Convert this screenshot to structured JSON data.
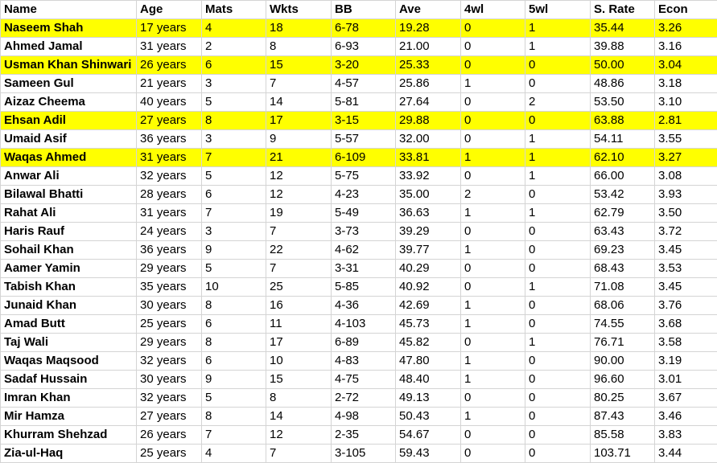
{
  "columns": [
    "Name",
    "Age",
    "Mats",
    "Wkts",
    "BB",
    "Ave",
    "4wl",
    "5wl",
    "S. Rate",
    "Econ"
  ],
  "highlight_color": "#ffff00",
  "rows": [
    {
      "name": "Naseem Shah",
      "age": "17 years",
      "mats": "4",
      "wkts": "18",
      "bb": "6-78",
      "ave": "19.28",
      "w4": "0",
      "w5": "1",
      "sr": "35.44",
      "econ": "3.26",
      "highlighted": true
    },
    {
      "name": "Ahmed Jamal",
      "age": "31 years",
      "mats": "2",
      "wkts": "8",
      "bb": "6-93",
      "ave": "21.00",
      "w4": "0",
      "w5": "1",
      "sr": "39.88",
      "econ": "3.16",
      "highlighted": false
    },
    {
      "name": "Usman Khan Shinwari",
      "age": "26 years",
      "mats": "6",
      "wkts": "15",
      "bb": "3-20",
      "ave": "25.33",
      "w4": "0",
      "w5": "0",
      "sr": "50.00",
      "econ": "3.04",
      "highlighted": true
    },
    {
      "name": "Sameen Gul",
      "age": "21 years",
      "mats": "3",
      "wkts": "7",
      "bb": "4-57",
      "ave": "25.86",
      "w4": "1",
      "w5": "0",
      "sr": "48.86",
      "econ": "3.18",
      "highlighted": false
    },
    {
      "name": "Aizaz Cheema",
      "age": "40 years",
      "mats": "5",
      "wkts": "14",
      "bb": "5-81",
      "ave": "27.64",
      "w4": "0",
      "w5": "2",
      "sr": "53.50",
      "econ": "3.10",
      "highlighted": false
    },
    {
      "name": "Ehsan Adil",
      "age": "27 years",
      "mats": "8",
      "wkts": "17",
      "bb": "3-15",
      "ave": "29.88",
      "w4": "0",
      "w5": "0",
      "sr": "63.88",
      "econ": "2.81",
      "highlighted": true
    },
    {
      "name": "Umaid Asif",
      "age": "36 years",
      "mats": "3",
      "wkts": "9",
      "bb": "5-57",
      "ave": "32.00",
      "w4": "0",
      "w5": "1",
      "sr": "54.11",
      "econ": "3.55",
      "highlighted": false
    },
    {
      "name": "Waqas Ahmed",
      "age": "31 years",
      "mats": "7",
      "wkts": "21",
      "bb": "6-109",
      "ave": "33.81",
      "w4": "1",
      "w5": "1",
      "sr": "62.10",
      "econ": "3.27",
      "highlighted": true
    },
    {
      "name": "Anwar Ali",
      "age": "32 years",
      "mats": "5",
      "wkts": "12",
      "bb": "5-75",
      "ave": "33.92",
      "w4": "0",
      "w5": "1",
      "sr": "66.00",
      "econ": "3.08",
      "highlighted": false
    },
    {
      "name": "Bilawal Bhatti",
      "age": "28 years",
      "mats": "6",
      "wkts": "12",
      "bb": "4-23",
      "ave": "35.00",
      "w4": "2",
      "w5": "0",
      "sr": "53.42",
      "econ": "3.93",
      "highlighted": false
    },
    {
      "name": "Rahat Ali",
      "age": "31 years",
      "mats": "7",
      "wkts": "19",
      "bb": "5-49",
      "ave": "36.63",
      "w4": "1",
      "w5": "1",
      "sr": "62.79",
      "econ": "3.50",
      "highlighted": false
    },
    {
      "name": "Haris Rauf",
      "age": "24 years",
      "mats": "3",
      "wkts": "7",
      "bb": "3-73",
      "ave": "39.29",
      "w4": "0",
      "w5": "0",
      "sr": "63.43",
      "econ": "3.72",
      "highlighted": false
    },
    {
      "name": "Sohail Khan",
      "age": "36 years",
      "mats": "9",
      "wkts": "22",
      "bb": "4-62",
      "ave": "39.77",
      "w4": "1",
      "w5": "0",
      "sr": "69.23",
      "econ": "3.45",
      "highlighted": false
    },
    {
      "name": "Aamer Yamin",
      "age": "29 years",
      "mats": "5",
      "wkts": "7",
      "bb": "3-31",
      "ave": "40.29",
      "w4": "0",
      "w5": "0",
      "sr": "68.43",
      "econ": "3.53",
      "highlighted": false
    },
    {
      "name": "Tabish Khan",
      "age": "35 years",
      "mats": "10",
      "wkts": "25",
      "bb": "5-85",
      "ave": "40.92",
      "w4": "0",
      "w5": "1",
      "sr": "71.08",
      "econ": "3.45",
      "highlighted": false
    },
    {
      "name": "Junaid Khan",
      "age": "30 years",
      "mats": "8",
      "wkts": "16",
      "bb": "4-36",
      "ave": "42.69",
      "w4": "1",
      "w5": "0",
      "sr": "68.06",
      "econ": "3.76",
      "highlighted": false
    },
    {
      "name": "Amad Butt",
      "age": "25 years",
      "mats": "6",
      "wkts": "11",
      "bb": "4-103",
      "ave": "45.73",
      "w4": "1",
      "w5": "0",
      "sr": "74.55",
      "econ": "3.68",
      "highlighted": false
    },
    {
      "name": "Taj Wali",
      "age": "29 years",
      "mats": "8",
      "wkts": "17",
      "bb": "6-89",
      "ave": "45.82",
      "w4": "0",
      "w5": "1",
      "sr": "76.71",
      "econ": "3.58",
      "highlighted": false
    },
    {
      "name": "Waqas Maqsood",
      "age": "32 years",
      "mats": "6",
      "wkts": "10",
      "bb": "4-83",
      "ave": "47.80",
      "w4": "1",
      "w5": "0",
      "sr": "90.00",
      "econ": "3.19",
      "highlighted": false
    },
    {
      "name": "Sadaf Hussain",
      "age": "30 years",
      "mats": "9",
      "wkts": "15",
      "bb": "4-75",
      "ave": "48.40",
      "w4": "1",
      "w5": "0",
      "sr": "96.60",
      "econ": "3.01",
      "highlighted": false
    },
    {
      "name": "Imran Khan",
      "age": "32 years",
      "mats": "5",
      "wkts": "8",
      "bb": "2-72",
      "ave": "49.13",
      "w4": "0",
      "w5": "0",
      "sr": "80.25",
      "econ": "3.67",
      "highlighted": false
    },
    {
      "name": "Mir Hamza",
      "age": "27 years",
      "mats": "8",
      "wkts": "14",
      "bb": "4-98",
      "ave": "50.43",
      "w4": "1",
      "w5": "0",
      "sr": "87.43",
      "econ": "3.46",
      "highlighted": false
    },
    {
      "name": "Khurram Shehzad",
      "age": "26 years",
      "mats": "7",
      "wkts": "12",
      "bb": "2-35",
      "ave": "54.67",
      "w4": "0",
      "w5": "0",
      "sr": "85.58",
      "econ": "3.83",
      "highlighted": false
    },
    {
      "name": "Zia-ul-Haq",
      "age": "25 years",
      "mats": "4",
      "wkts": "7",
      "bb": "3-105",
      "ave": "59.43",
      "w4": "0",
      "w5": "0",
      "sr": "103.71",
      "econ": "3.44",
      "highlighted": false
    }
  ]
}
